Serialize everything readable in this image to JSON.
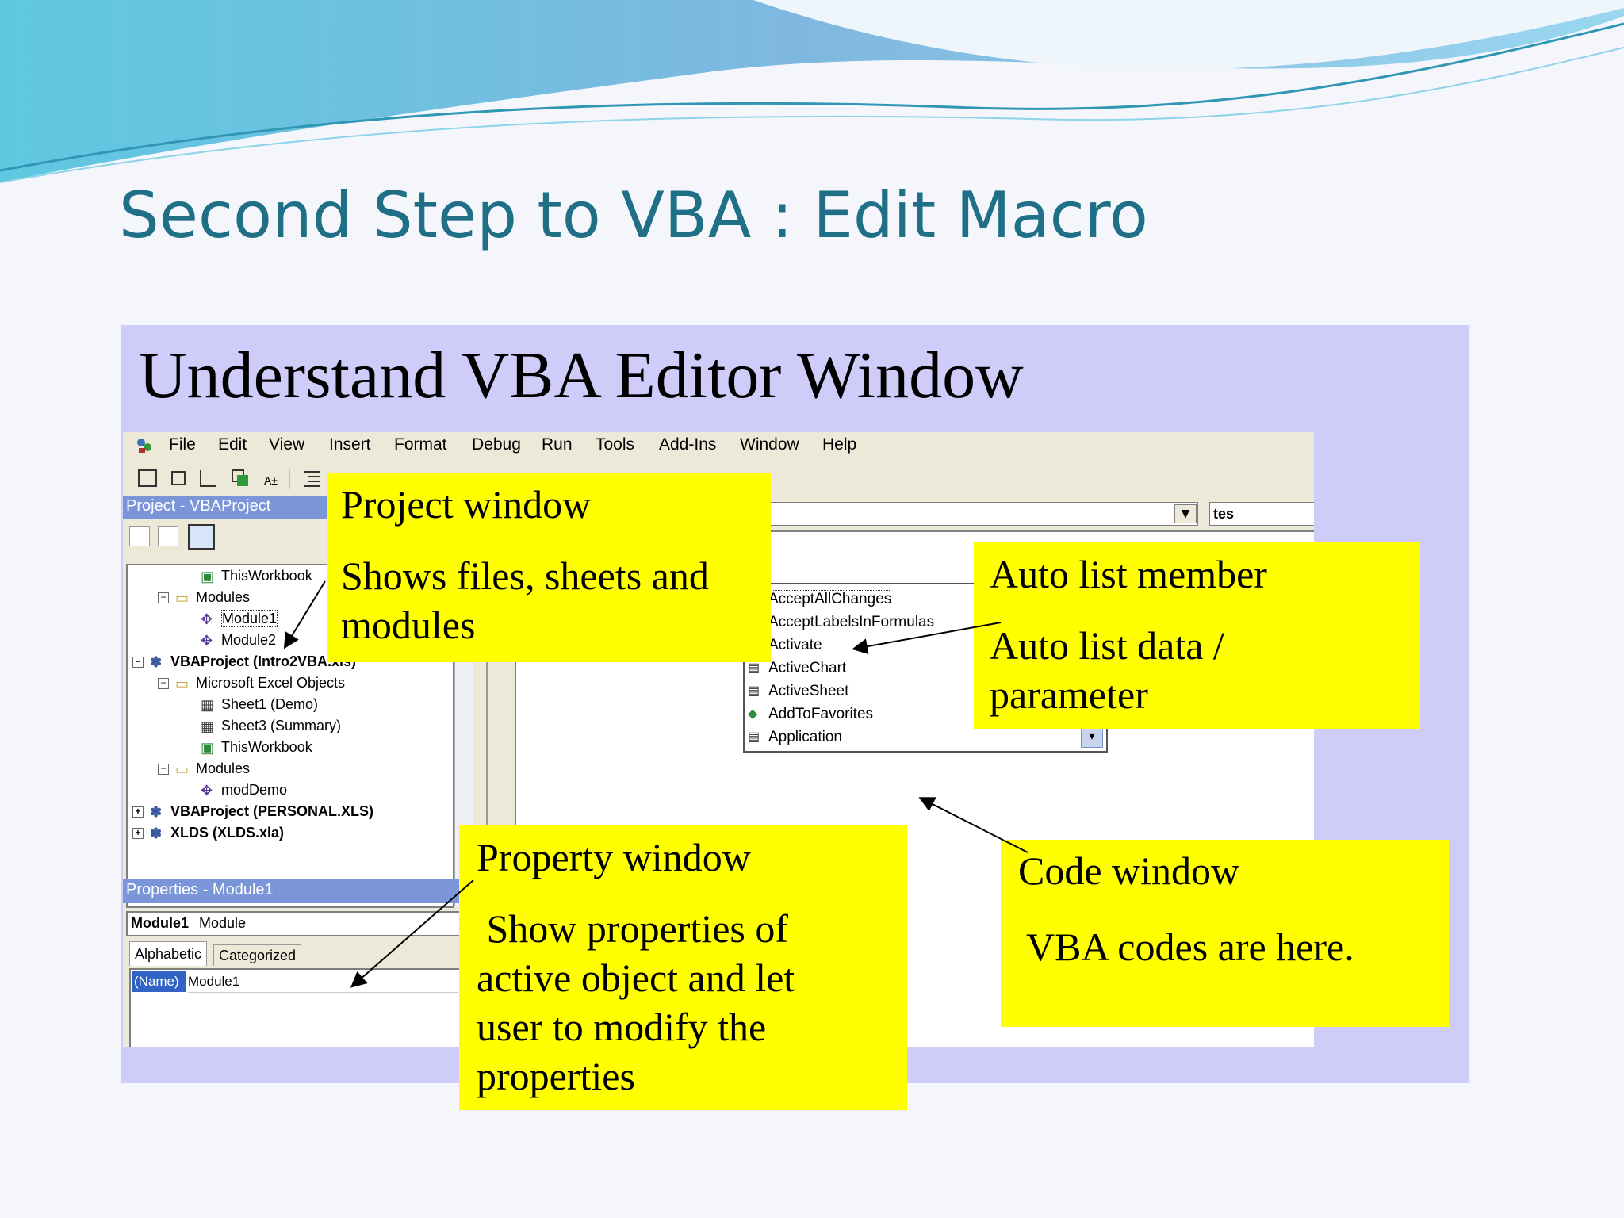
{
  "slide_title": "Second Step to VBA : Edit Macro",
  "panel_title": "Understand VBA Editor Window",
  "vbe": {
    "menu": [
      "File",
      "Edit",
      "View",
      "Insert",
      "Format",
      "Debug",
      "Run",
      "Tools",
      "Add-Ins",
      "Window",
      "Help"
    ],
    "menu_underline": [
      "F",
      "E",
      "V",
      "I",
      "o",
      "D",
      "R",
      "T",
      "A",
      "W",
      "H"
    ],
    "project_title": "Project - VBAProject",
    "tree": [
      {
        "label": "ThisWorkbook",
        "level": 3,
        "icon": "excel-sheet-icon",
        "bold": false,
        "expander": ""
      },
      {
        "label": "Modules",
        "level": 2,
        "icon": "folder-icon",
        "bold": false,
        "expander": "−"
      },
      {
        "label": "Module1",
        "level": 3,
        "icon": "module-icon",
        "bold": false,
        "expander": "",
        "selected": true
      },
      {
        "label": "Module2",
        "level": 3,
        "icon": "module-icon",
        "bold": false,
        "expander": ""
      },
      {
        "label": "VBAProject (Intro2VBA.xls)",
        "level": 1,
        "icon": "project-icon",
        "bold": true,
        "expander": "−"
      },
      {
        "label": "Microsoft Excel Objects",
        "level": 2,
        "icon": "folder-icon",
        "bold": false,
        "expander": "−"
      },
      {
        "label": "Sheet1 (Demo)",
        "level": 3,
        "icon": "worksheet-icon",
        "bold": false,
        "expander": ""
      },
      {
        "label": "Sheet3 (Summary)",
        "level": 3,
        "icon": "worksheet-icon",
        "bold": false,
        "expander": ""
      },
      {
        "label": "ThisWorkbook",
        "level": 3,
        "icon": "excel-sheet-icon",
        "bold": false,
        "expander": ""
      },
      {
        "label": "Modules",
        "level": 2,
        "icon": "folder-icon",
        "bold": false,
        "expander": "−"
      },
      {
        "label": "modDemo",
        "level": 3,
        "icon": "module-icon",
        "bold": false,
        "expander": ""
      },
      {
        "label": "VBAProject (PERSONAL.XLS)",
        "level": 1,
        "icon": "project-icon",
        "bold": true,
        "expander": "+"
      },
      {
        "label": "XLDS (XLDS.xla)",
        "level": 1,
        "icon": "project-icon",
        "bold": true,
        "expander": "+"
      }
    ],
    "properties_title": "Properties - Module1",
    "properties_object": "Module1",
    "properties_object_type": "Module",
    "properties_tabs": [
      "Alphabetic",
      "Categorized"
    ],
    "property_name": "(Name)",
    "property_value": "Module1",
    "code_combo_right": "tes",
    "auto_list": [
      "AcceptAllChanges",
      "AcceptLabelsInFormulas",
      "Activate",
      "ActiveChart",
      "ActiveSheet",
      "AddToFavorites",
      "Application"
    ]
  },
  "callouts": {
    "project": {
      "title": "Project window",
      "body": [
        "Shows files, sheets and",
        "modules"
      ]
    },
    "auto_list": {
      "title": "Auto list member",
      "body": [
        "Auto list data /",
        "parameter"
      ]
    },
    "property": {
      "title": "Property window",
      "body": [
        " Show properties of",
        "active object and let",
        "user to modify the",
        "properties"
      ]
    },
    "code": {
      "title": "Code window",
      "body": [
        "VBA codes are here."
      ]
    }
  },
  "colors": {
    "title": "#1f6f86",
    "panel": "#cfccfa",
    "callout": "#ffff00",
    "pane_title": "#7b96d8"
  }
}
